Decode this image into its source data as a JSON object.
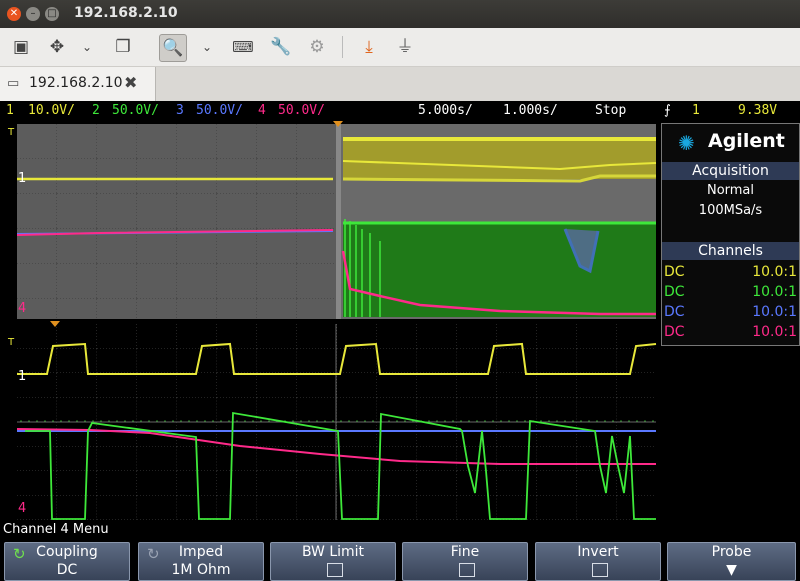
{
  "window": {
    "title": "192.168.2.10"
  },
  "tab": {
    "label": "192.168.2.10"
  },
  "toolbar": {
    "icons": [
      "screen-icon",
      "move-icon",
      "chevron-down-icon",
      "windows-icon",
      "zoom-icon",
      "chevron-down-icon",
      "keyboard-icon",
      "wrench-icon",
      "gears-icon",
      "download-icon",
      "plug-icon"
    ]
  },
  "status": {
    "ch1_num": "1",
    "ch1_scale": "10.0V/",
    "ch2_num": "2",
    "ch2_scale": "50.0V/",
    "ch3_num": "3",
    "ch3_scale": "50.0V/",
    "ch4_num": "4",
    "ch4_scale": "50.0V/",
    "timebase": "5.000s/",
    "delay": "1.000s/",
    "run_state": "Stop",
    "trig_src": "1",
    "trig_level": "9.38V"
  },
  "panel": {
    "brand": "Agilent",
    "acq_title": "Acquisition",
    "acq_mode": "Normal",
    "acq_rate": "100MSa/s",
    "channels_title": "Channels",
    "channels": [
      {
        "coupling": "DC",
        "probe": "10.0:1",
        "color": "#e8e83a"
      },
      {
        "coupling": "DC",
        "probe": "10.0:1",
        "color": "#3ee83a"
      },
      {
        "coupling": "DC",
        "probe": "10.0:1",
        "color": "#5a78ff"
      },
      {
        "coupling": "DC",
        "probe": "10.0:1",
        "color": "#ff2a8a"
      }
    ]
  },
  "markers": {
    "t_label": "T",
    "ch1_marker": "1",
    "ch4_marker": "4"
  },
  "menu": {
    "title": "Channel 4 Menu",
    "softkeys": [
      {
        "title": "Coupling",
        "value": "DC"
      },
      {
        "title": "Imped",
        "value": "1M Ohm"
      },
      {
        "title": "BW Limit",
        "value": ""
      },
      {
        "title": "Fine",
        "value": ""
      },
      {
        "title": "Invert",
        "value": ""
      },
      {
        "title": "Probe",
        "value": ""
      }
    ]
  },
  "colors": {
    "ch1": "#e8e83a",
    "ch2": "#3ee83a",
    "ch3": "#5a78ff",
    "ch4": "#ff2a8a",
    "menu_accent": "#2e3a55"
  }
}
